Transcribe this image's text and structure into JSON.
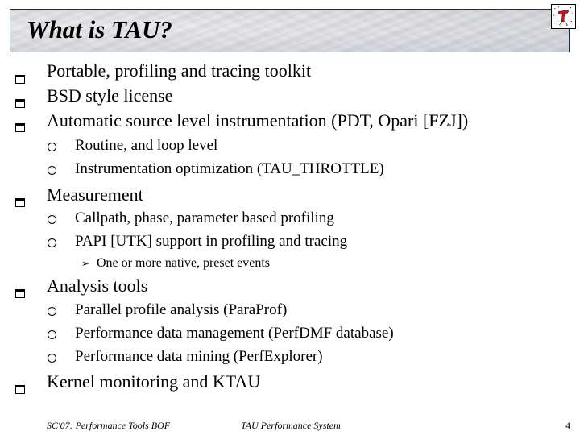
{
  "slide": {
    "title": "What is TAU?",
    "logo_icon": "tau-logo-icon",
    "bullets": [
      {
        "level": 1,
        "text": "Portable, profiling and tracing toolkit"
      },
      {
        "level": 1,
        "text": "BSD style license"
      },
      {
        "level": 1,
        "text": "Automatic source level instrumentation (PDT, Opari [FZJ])"
      },
      {
        "level": 2,
        "text": "Routine, and loop level"
      },
      {
        "level": 2,
        "text": "Instrumentation optimization (TAU_THROTTLE)"
      },
      {
        "level": 1,
        "text": "Measurement"
      },
      {
        "level": 2,
        "text": "Callpath, phase, parameter based profiling"
      },
      {
        "level": 2,
        "text": "PAPI [UTK] support in profiling and tracing"
      },
      {
        "level": 3,
        "text": "One or more native, preset events"
      },
      {
        "level": 1,
        "text": "Analysis tools"
      },
      {
        "level": 2,
        "text": "Parallel profile analysis (ParaProf)"
      },
      {
        "level": 2,
        "text": "Performance data management (PerfDMF database)"
      },
      {
        "level": 2,
        "text": "Performance data mining (PerfExplorer)"
      },
      {
        "level": 1,
        "text": "Kernel monitoring and KTAU"
      }
    ],
    "bullet_icons": {
      "level1": "square-bullet-icon",
      "level2": "circle-bullet-icon",
      "level3": "arrowhead-bullet-icon"
    },
    "level3_glyph": "➢",
    "colors": {
      "logo_red": "#c8161d",
      "banner_border": "#1f2f3f"
    }
  },
  "footer": {
    "left": "SC'07: Performance Tools BOF",
    "center": "TAU Performance System",
    "page_number": "4"
  }
}
